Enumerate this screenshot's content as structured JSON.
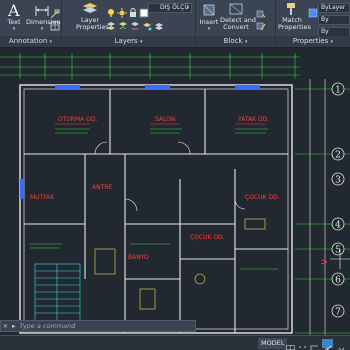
{
  "ribbon": {
    "annotation": {
      "title": "Annotation",
      "text_label": "Text",
      "dimension_label": "Dimension"
    },
    "layers": {
      "title": "Layers",
      "layer_properties_label": "Layer\nProperties",
      "current_layer": "DIŞ ÖLÇÜ"
    },
    "insert": {
      "insert_label": "Insert"
    },
    "block": {
      "title": "Block",
      "edit_label": "Detect and\nConvert"
    },
    "properties": {
      "title": "Properties",
      "match_label": "Match\nProperties",
      "bylayer_value": "ByLayer",
      "bylayer_short_1": "By",
      "bylayer_short_2": "By"
    }
  },
  "drawing": {
    "rooms": [
      {
        "name": "OTURMA OD.",
        "color": "#ff3b3b"
      },
      {
        "name": "SALON",
        "color": "#ff3b3b"
      },
      {
        "name": "YATAK OD.",
        "color": "#ff3b3b"
      },
      {
        "name": "MUTFAK",
        "color": "#ff3b3b"
      },
      {
        "name": "ANTRE",
        "color": "#ff3b3b"
      },
      {
        "name": "ÇOCUK OD.",
        "color": "#ff3b3b"
      },
      {
        "name": "BANYO",
        "color": "#ff3b3b"
      },
      {
        "name": "ÇOCUK OD.",
        "color": "#ff3b3b"
      }
    ],
    "axis_labels": [
      "1",
      "2",
      "3",
      "4",
      "5",
      "6",
      "7"
    ],
    "colors": {
      "wall": "#e8e8e8",
      "dimension": "#39d939",
      "room_text": "#ff3b3b",
      "door_window": "#3a6bff",
      "cyan": "#33e0e0",
      "yellow": "#f2e34a",
      "magenta": "#e04fe0"
    }
  },
  "command_line": {
    "placeholder": "Type a command"
  },
  "status_bar": {
    "model_label": "MODEL"
  }
}
